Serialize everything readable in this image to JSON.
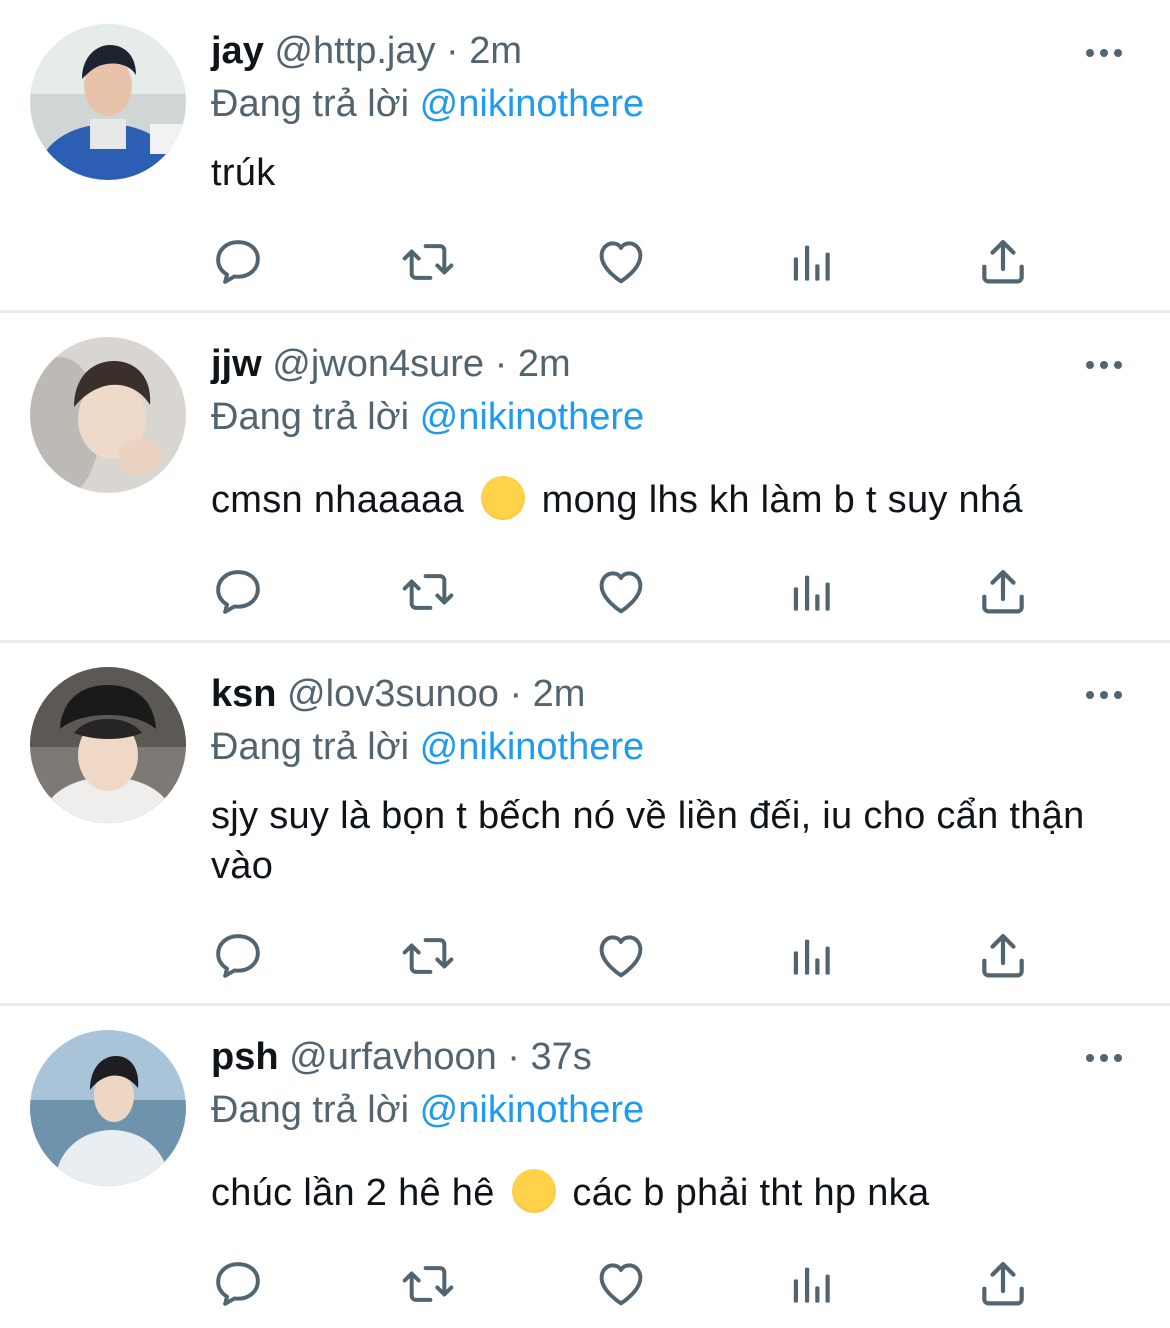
{
  "colors": {
    "accent": "#1d9bf0",
    "secondary": "#536471",
    "divider": "#e6ecf0"
  },
  "icons": [
    "reply-icon",
    "retweet-icon",
    "like-icon",
    "views-icon",
    "share-icon",
    "more-icon"
  ],
  "tweets": [
    {
      "name": "jay",
      "handle": "@http.jay",
      "separator": "·",
      "time": "2m",
      "reply_prefix": "Đang trả lời",
      "reply_to": "@nikinothere",
      "text": "trúk"
    },
    {
      "name": "jjw",
      "handle": "@jwon4sure",
      "separator": "·",
      "time": "2m",
      "reply_prefix": "Đang trả lời",
      "reply_to": "@nikinothere",
      "text_before": "cmsn nhaaaaa",
      "emoji": "partying-face-emoji",
      "text_after": "mong lhs kh làm b t suy nhá"
    },
    {
      "name": "ksn",
      "handle": "@lov3sunoo",
      "separator": "·",
      "time": "2m",
      "reply_prefix": "Đang trả lời",
      "reply_to": "@nikinothere",
      "text": "sjy suy là bọn t bếch nó về liền đếi, iu cho cẩn thận vào"
    },
    {
      "name": "psh",
      "handle": "@urfavhoon",
      "separator": "·",
      "time": "37s",
      "reply_prefix": "Đang trả lời",
      "reply_to": "@nikinothere",
      "text_before": "chúc lần 2 hê hê",
      "emoji": "star-struck-emoji",
      "text_after": "các b phải tht hp nka"
    }
  ]
}
